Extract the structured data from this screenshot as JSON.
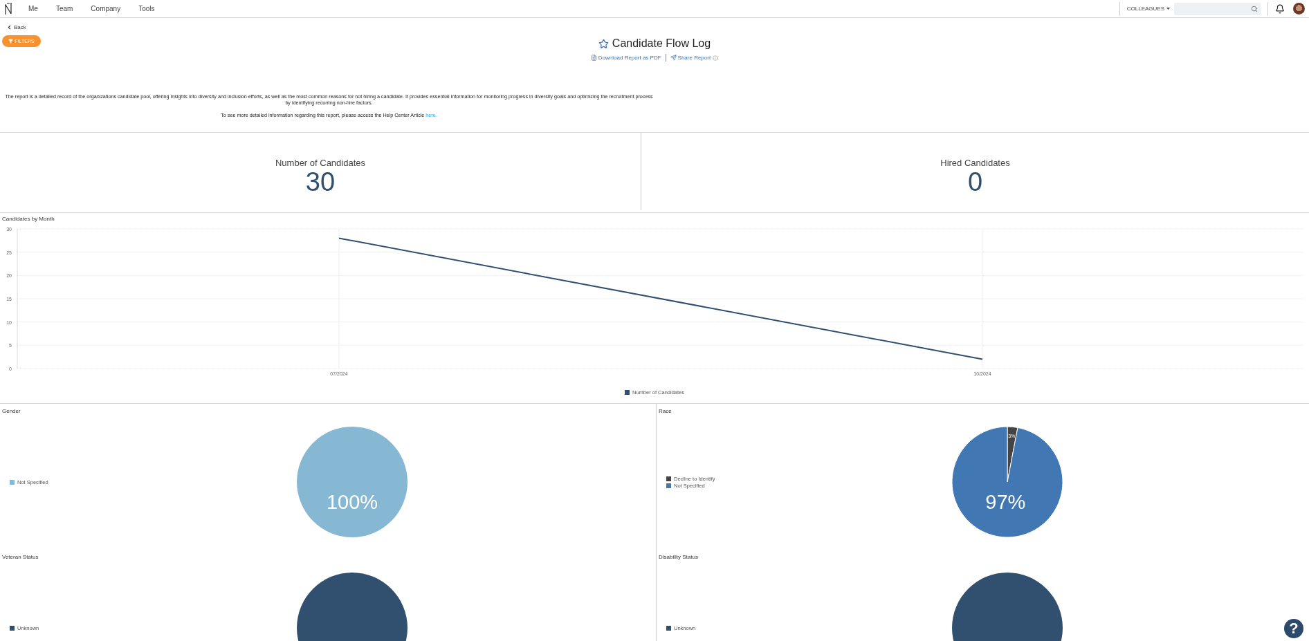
{
  "nav": {
    "items": [
      {
        "label": "Me"
      },
      {
        "label": "Team"
      },
      {
        "label": "Company"
      },
      {
        "label": "Tools"
      }
    ],
    "colleagues": "COLLEAGUES"
  },
  "back": "Back",
  "filters": "FILTERS",
  "report": {
    "title": "Candidate Flow Log",
    "favorite": false,
    "actions": [
      {
        "label": "Download Report as PDF",
        "kind": "download"
      },
      {
        "label": "Share Report",
        "kind": "share"
      }
    ]
  },
  "description": {
    "text": "The report is a detailed record of the organizations candidate pool, offering insights into diversity and inclusion efforts, as well as the most common reasons for not hiring a candidate. It provides essential information for monitoring progress in diversity goals and optimizing the recruitment process by identifying recurring non-hire factors.",
    "help_text": "To see more detailed information regarding this report, please access the Help Center Article",
    "help_link": "here."
  },
  "stats": [
    {
      "label": "Number of Candidates",
      "value": "30"
    },
    {
      "label": "Hired Candidates",
      "value": "0"
    }
  ],
  "trend": {
    "chart_data": {
      "type": "line",
      "title": "Candidates by Month",
      "categories": [
        "07/2024",
        "10/2024"
      ],
      "ylim": [
        0,
        30
      ],
      "yticks": [
        0,
        5,
        10,
        15,
        20,
        25,
        30
      ],
      "grid": true,
      "series": [
        {
          "name": "Number of Candidates",
          "color": "#31506f",
          "values": [
            28,
            2
          ]
        }
      ]
    }
  },
  "breakdowns": [
    {
      "chart_data": {
        "type": "pie",
        "title": "Gender",
        "categories": [
          "Not Specified"
        ],
        "colors": [
          "#87b8d3"
        ],
        "values": [
          100
        ],
        "value_labels": [
          "100%"
        ]
      }
    },
    {
      "chart_data": {
        "type": "pie",
        "title": "Race",
        "categories": [
          "Decline to Identify",
          "Not Specified"
        ],
        "colors": [
          "#444444",
          "#4178b3"
        ],
        "values": [
          3,
          97
        ],
        "value_labels": [
          "3%",
          "97%"
        ]
      }
    },
    {
      "chart_data": {
        "type": "pie",
        "title": "Veteran Status",
        "categories": [
          "Unknown"
        ],
        "colors": [
          "#31506f"
        ],
        "values": [
          100
        ]
      }
    },
    {
      "chart_data": {
        "type": "pie",
        "title": "Disability Status",
        "categories": [
          "Unknown"
        ],
        "colors": [
          "#31506f"
        ],
        "values": [
          100
        ]
      }
    }
  ],
  "help_button": {
    "label": "?"
  }
}
